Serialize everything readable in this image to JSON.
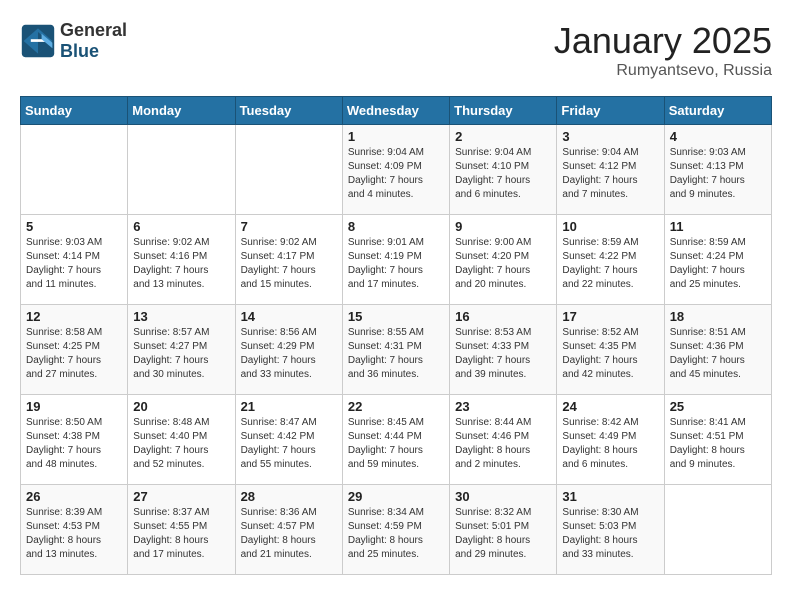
{
  "header": {
    "logo_general": "General",
    "logo_blue": "Blue",
    "title": "January 2025",
    "subtitle": "Rumyantsevo, Russia"
  },
  "days_of_week": [
    "Sunday",
    "Monday",
    "Tuesday",
    "Wednesday",
    "Thursday",
    "Friday",
    "Saturday"
  ],
  "weeks": [
    [
      {
        "day": "",
        "info": ""
      },
      {
        "day": "",
        "info": ""
      },
      {
        "day": "",
        "info": ""
      },
      {
        "day": "1",
        "info": "Sunrise: 9:04 AM\nSunset: 4:09 PM\nDaylight: 7 hours\nand 4 minutes."
      },
      {
        "day": "2",
        "info": "Sunrise: 9:04 AM\nSunset: 4:10 PM\nDaylight: 7 hours\nand 6 minutes."
      },
      {
        "day": "3",
        "info": "Sunrise: 9:04 AM\nSunset: 4:12 PM\nDaylight: 7 hours\nand 7 minutes."
      },
      {
        "day": "4",
        "info": "Sunrise: 9:03 AM\nSunset: 4:13 PM\nDaylight: 7 hours\nand 9 minutes."
      }
    ],
    [
      {
        "day": "5",
        "info": "Sunrise: 9:03 AM\nSunset: 4:14 PM\nDaylight: 7 hours\nand 11 minutes."
      },
      {
        "day": "6",
        "info": "Sunrise: 9:02 AM\nSunset: 4:16 PM\nDaylight: 7 hours\nand 13 minutes."
      },
      {
        "day": "7",
        "info": "Sunrise: 9:02 AM\nSunset: 4:17 PM\nDaylight: 7 hours\nand 15 minutes."
      },
      {
        "day": "8",
        "info": "Sunrise: 9:01 AM\nSunset: 4:19 PM\nDaylight: 7 hours\nand 17 minutes."
      },
      {
        "day": "9",
        "info": "Sunrise: 9:00 AM\nSunset: 4:20 PM\nDaylight: 7 hours\nand 20 minutes."
      },
      {
        "day": "10",
        "info": "Sunrise: 8:59 AM\nSunset: 4:22 PM\nDaylight: 7 hours\nand 22 minutes."
      },
      {
        "day": "11",
        "info": "Sunrise: 8:59 AM\nSunset: 4:24 PM\nDaylight: 7 hours\nand 25 minutes."
      }
    ],
    [
      {
        "day": "12",
        "info": "Sunrise: 8:58 AM\nSunset: 4:25 PM\nDaylight: 7 hours\nand 27 minutes."
      },
      {
        "day": "13",
        "info": "Sunrise: 8:57 AM\nSunset: 4:27 PM\nDaylight: 7 hours\nand 30 minutes."
      },
      {
        "day": "14",
        "info": "Sunrise: 8:56 AM\nSunset: 4:29 PM\nDaylight: 7 hours\nand 33 minutes."
      },
      {
        "day": "15",
        "info": "Sunrise: 8:55 AM\nSunset: 4:31 PM\nDaylight: 7 hours\nand 36 minutes."
      },
      {
        "day": "16",
        "info": "Sunrise: 8:53 AM\nSunset: 4:33 PM\nDaylight: 7 hours\nand 39 minutes."
      },
      {
        "day": "17",
        "info": "Sunrise: 8:52 AM\nSunset: 4:35 PM\nDaylight: 7 hours\nand 42 minutes."
      },
      {
        "day": "18",
        "info": "Sunrise: 8:51 AM\nSunset: 4:36 PM\nDaylight: 7 hours\nand 45 minutes."
      }
    ],
    [
      {
        "day": "19",
        "info": "Sunrise: 8:50 AM\nSunset: 4:38 PM\nDaylight: 7 hours\nand 48 minutes."
      },
      {
        "day": "20",
        "info": "Sunrise: 8:48 AM\nSunset: 4:40 PM\nDaylight: 7 hours\nand 52 minutes."
      },
      {
        "day": "21",
        "info": "Sunrise: 8:47 AM\nSunset: 4:42 PM\nDaylight: 7 hours\nand 55 minutes."
      },
      {
        "day": "22",
        "info": "Sunrise: 8:45 AM\nSunset: 4:44 PM\nDaylight: 7 hours\nand 59 minutes."
      },
      {
        "day": "23",
        "info": "Sunrise: 8:44 AM\nSunset: 4:46 PM\nDaylight: 8 hours\nand 2 minutes."
      },
      {
        "day": "24",
        "info": "Sunrise: 8:42 AM\nSunset: 4:49 PM\nDaylight: 8 hours\nand 6 minutes."
      },
      {
        "day": "25",
        "info": "Sunrise: 8:41 AM\nSunset: 4:51 PM\nDaylight: 8 hours\nand 9 minutes."
      }
    ],
    [
      {
        "day": "26",
        "info": "Sunrise: 8:39 AM\nSunset: 4:53 PM\nDaylight: 8 hours\nand 13 minutes."
      },
      {
        "day": "27",
        "info": "Sunrise: 8:37 AM\nSunset: 4:55 PM\nDaylight: 8 hours\nand 17 minutes."
      },
      {
        "day": "28",
        "info": "Sunrise: 8:36 AM\nSunset: 4:57 PM\nDaylight: 8 hours\nand 21 minutes."
      },
      {
        "day": "29",
        "info": "Sunrise: 8:34 AM\nSunset: 4:59 PM\nDaylight: 8 hours\nand 25 minutes."
      },
      {
        "day": "30",
        "info": "Sunrise: 8:32 AM\nSunset: 5:01 PM\nDaylight: 8 hours\nand 29 minutes."
      },
      {
        "day": "31",
        "info": "Sunrise: 8:30 AM\nSunset: 5:03 PM\nDaylight: 8 hours\nand 33 minutes."
      },
      {
        "day": "",
        "info": ""
      }
    ]
  ]
}
